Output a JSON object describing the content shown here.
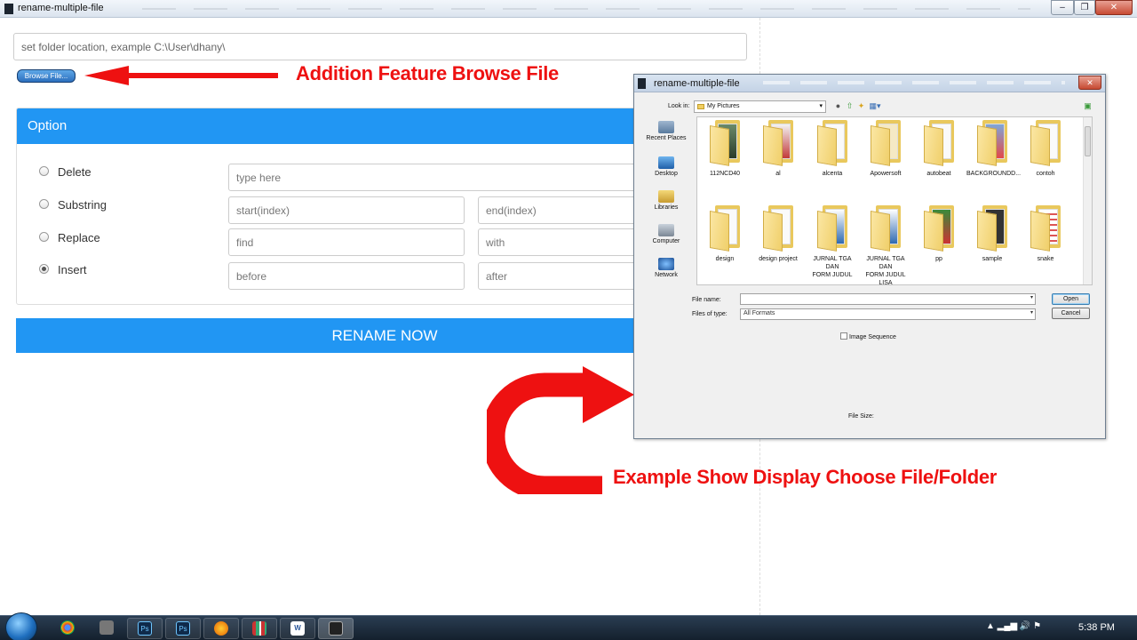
{
  "window": {
    "title": "rename-multiple-file",
    "buttons": [
      "–",
      "❐",
      "✕"
    ]
  },
  "main": {
    "folder_placeholder": "set folder location, example C:\\User\\dhany\\",
    "browse_label": "Browse File...",
    "option_title": "Option",
    "options": [
      {
        "label": "Delete",
        "selected": false,
        "fields": [
          "type here"
        ]
      },
      {
        "label": "Substring",
        "selected": false,
        "fields": [
          "start(index)",
          "end(index)"
        ]
      },
      {
        "label": "Replace",
        "selected": false,
        "fields": [
          "find",
          "with"
        ]
      },
      {
        "label": "Insert",
        "selected": true,
        "fields": [
          "before",
          "after"
        ]
      }
    ],
    "rename_label": "RENAME NOW"
  },
  "annotations": {
    "browse": "Addition Feature Browse File",
    "dialog": "Example Show Display Choose File/Folder",
    "color": "#ee1111"
  },
  "dialog": {
    "title": "rename-multiple-file",
    "close": "✕",
    "look_in_label": "Look in:",
    "look_in_value": "My Pictures",
    "places": [
      "Recent Places",
      "Desktop",
      "Libraries",
      "Computer",
      "Network"
    ],
    "files": [
      [
        "112NCD40"
      ],
      [
        "al"
      ],
      [
        "alcenta"
      ],
      [
        "Apowersoft"
      ],
      [
        "autobeat"
      ],
      [
        "BACKGROUNDD..."
      ],
      [
        "contoh"
      ],
      [
        "design"
      ],
      [
        "design project"
      ],
      [
        "JURNAL TGA DAN",
        "FORM JUDUL"
      ],
      [
        "JURNAL TGA DAN",
        "FORM JUDUL LISA"
      ],
      [
        "pp"
      ],
      [
        "sample"
      ],
      [
        "snake"
      ]
    ],
    "file_name_label": "File name:",
    "file_name_value": "",
    "files_of_type_label": "Files of type:",
    "files_of_type_value": "All Formats",
    "open_label": "Open",
    "cancel_label": "Cancel",
    "image_sequence_label": "Image Sequence",
    "file_size_label": "File Size:"
  },
  "taskbar": {
    "apps": [
      "chrome",
      "camera",
      "Ps",
      "Ps",
      "firefox",
      "books",
      "W",
      "app"
    ],
    "tray": "▲  ▂▄▆  🔊  ⚑",
    "clock": "5:38 PM"
  },
  "colors": {
    "accent": "#2196f3",
    "annotation": "#ee1111"
  }
}
